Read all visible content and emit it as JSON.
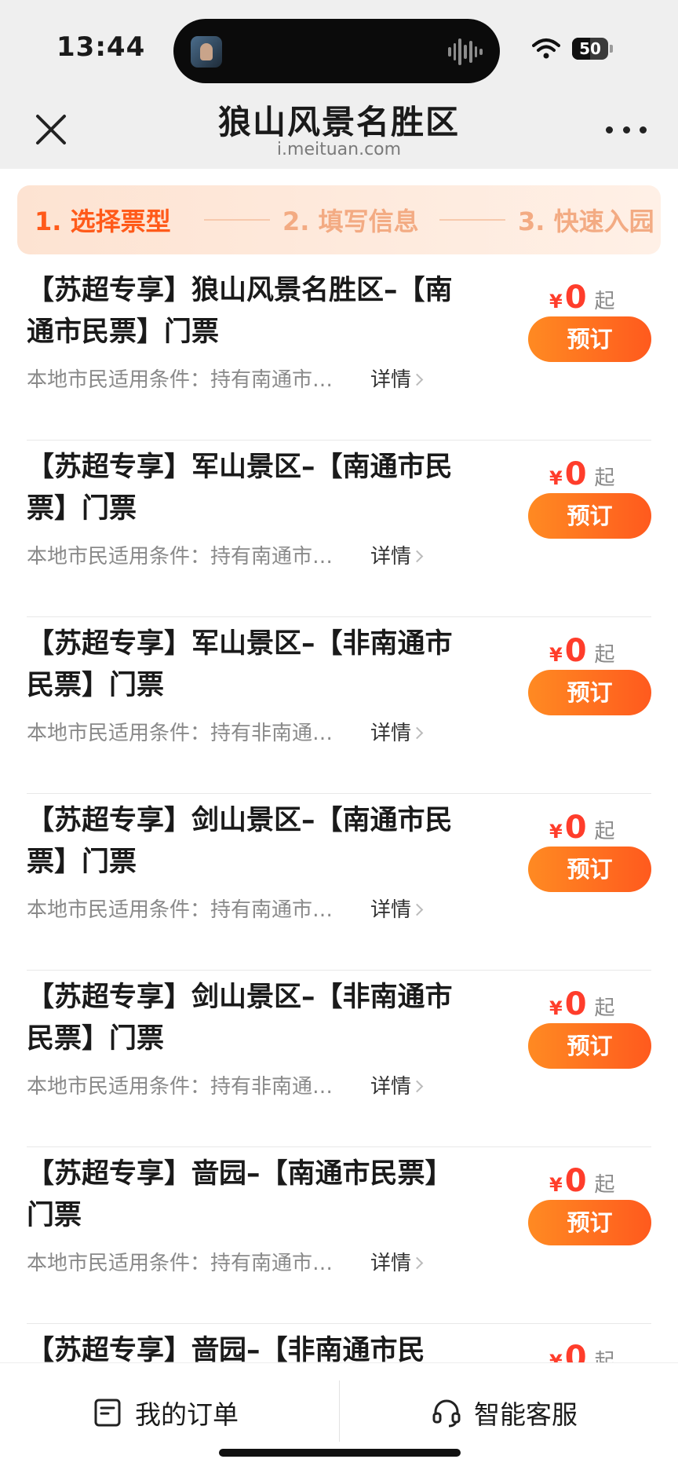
{
  "status_bar": {
    "time": "13:44",
    "battery": "50",
    "battery_level": 0.5
  },
  "header": {
    "title": "狼山风景名胜区",
    "url": "i.meituan.com"
  },
  "steps": [
    {
      "label": "1. 选择票型",
      "active": true
    },
    {
      "label": "2. 填写信息",
      "active": false
    },
    {
      "label": "3. 快速入园",
      "active": false
    }
  ],
  "tickets": [
    {
      "title": "【苏超专享】狼山风景名胜区–【南通市民票】门票",
      "desc": "本地市民适用条件：持有南通市…",
      "detail": "详情",
      "currency": "¥",
      "price": "0",
      "price_suffix": "起",
      "button": "预订"
    },
    {
      "title": "【苏超专享】军山景区–【南通市民票】门票",
      "desc": "本地市民适用条件：持有南通市…",
      "detail": "详情",
      "currency": "¥",
      "price": "0",
      "price_suffix": "起",
      "button": "预订"
    },
    {
      "title": "【苏超专享】军山景区–【非南通市民票】门票",
      "desc": "本地市民适用条件：持有非南通…",
      "detail": "详情",
      "currency": "¥",
      "price": "0",
      "price_suffix": "起",
      "button": "预订"
    },
    {
      "title": "【苏超专享】剑山景区–【南通市民票】门票",
      "desc": "本地市民适用条件：持有南通市…",
      "detail": "详情",
      "currency": "¥",
      "price": "0",
      "price_suffix": "起",
      "button": "预订"
    },
    {
      "title": "【苏超专享】剑山景区–【非南通市民票】门票",
      "desc": "本地市民适用条件：持有非南通…",
      "detail": "详情",
      "currency": "¥",
      "price": "0",
      "price_suffix": "起",
      "button": "预订"
    },
    {
      "title": "【苏超专享】啬园–【南通市民票】门票",
      "desc": "本地市民适用条件：持有南通市…",
      "detail": "详情",
      "currency": "¥",
      "price": "0",
      "price_suffix": "起",
      "button": "预订"
    },
    {
      "title": "【苏超专享】啬园–【非南通市民",
      "desc": "",
      "detail": "",
      "currency": "¥",
      "price": "0",
      "price_suffix": "起",
      "button": ""
    }
  ],
  "bottom_bar": {
    "orders_label": "我的订单",
    "service_label": "智能客服"
  },
  "colors": {
    "accent": "#ff5a1e",
    "price": "#ff3d2b",
    "step_active": "#ff5a1a",
    "step_inactive": "#f3ab83"
  }
}
